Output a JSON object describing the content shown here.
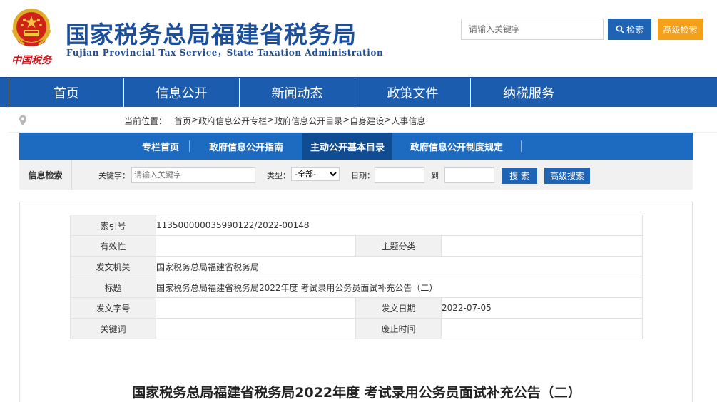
{
  "header": {
    "emblem_icon": "national-emblem-icon",
    "china_tax_logo": "中国税务",
    "title": "国家税务总局福建省税务局",
    "subtitle": "Fujian Provincial Tax Service，State Taxation Administration",
    "search_placeholder": "请输入关键字",
    "search_button": "检索",
    "advanced_button": "高级检索"
  },
  "main_nav": [
    "首页",
    "信息公开",
    "新闻动态",
    "政策文件",
    "纳税服务"
  ],
  "breadcrumb": {
    "prefix": "当前位置：",
    "items": [
      "首页",
      "政府信息公开专栏",
      "政府信息公开目录",
      "自身建设",
      "人事信息"
    ],
    "separator": " > "
  },
  "sub_nav": {
    "items": [
      "专栏首页",
      "政府信息公开指南",
      "主动公开基本目录",
      "政府信息公开制度规定"
    ],
    "active_index": 2
  },
  "filter": {
    "title": "信息检索",
    "keyword_label": "关键字：",
    "keyword_placeholder": "请输入关键字",
    "type_label": "类型：",
    "type_value": "-全部-",
    "date_label": "日期：",
    "to_label": "到",
    "search_button": "搜 索",
    "advanced_button": "高级搜索"
  },
  "info": {
    "index_label": "索引号",
    "index_value": "113500000035990122/2022-00148",
    "validity_label": "有效性",
    "validity_value": "",
    "topic_label": "主题分类",
    "topic_value": "",
    "issuer_label": "发文机关",
    "issuer_value": "国家税务总局福建省税务局",
    "title_label": "标题",
    "title_value": "国家税务总局福建省税务局2022年度 考试录用公务员面试补充公告（二）",
    "docno_label": "发文字号",
    "docno_value": "",
    "date_label": "发文日期",
    "date_value": "2022-07-05",
    "keyword_label": "关键词",
    "keyword_value": "",
    "expire_label": "废止时间",
    "expire_value": ""
  },
  "article_title": "国家税务总局福建省税务局2022年度 考试录用公务员面试补充公告（二）",
  "colors": {
    "brand_blue": "#1b4e9b",
    "nav_blue": "#1c5cae",
    "sub_nav_blue": "#1c6bc0",
    "active_blue": "#0f4c92",
    "orange": "#f5a01a",
    "red": "#c8161d"
  }
}
